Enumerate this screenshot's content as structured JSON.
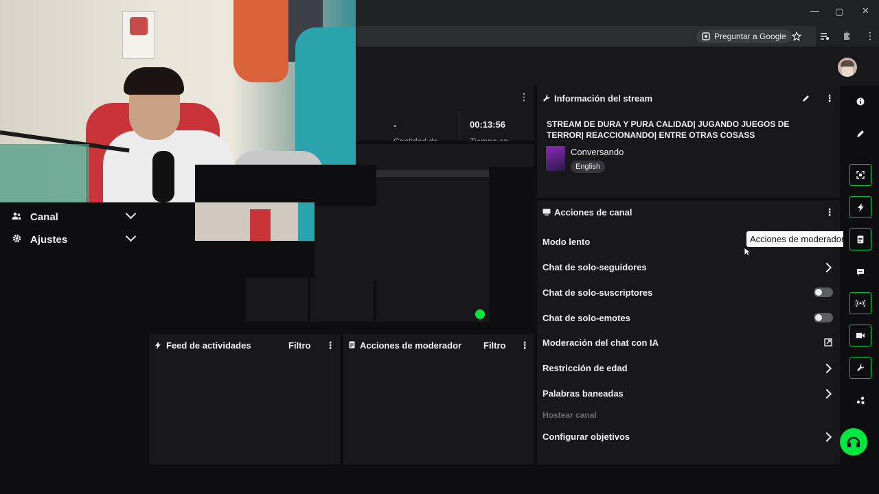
{
  "browser": {
    "ask_google": "Preguntar a Google",
    "controls": {
      "minimize": "—",
      "maximize": "▢",
      "close": "✕"
    }
  },
  "left_nav": {
    "items": [
      {
        "label": "Canal",
        "icon": "users-icon"
      },
      {
        "label": "Ajustes",
        "icon": "gear-icon"
      }
    ]
  },
  "top_stats": {
    "value1": "-",
    "value2": "00:13:56",
    "label1": "Cantidad de",
    "label2": "Tiempo en"
  },
  "stream_info": {
    "title": "Información del stream",
    "stream_title": "STREAM DE DURA Y PURA CALIDAD| JUGANDO JUEGOS DE TERROR| REACCIONANDO| ENTRE OTRAS COSASS",
    "category": "Conversando",
    "tag": "English",
    "icons": [
      "wrench-icon",
      "pencil-icon",
      "more-icon"
    ]
  },
  "channel_actions": {
    "title": "Acciones de canal",
    "rows": [
      {
        "label": "Modo lento",
        "control": "none"
      },
      {
        "label": "Chat de solo-seguidores",
        "control": "arrow"
      },
      {
        "label": "Chat de solo-suscriptores",
        "control": "toggle"
      },
      {
        "label": "Chat de solo-emotes",
        "control": "toggle"
      },
      {
        "label": "Moderación del chat con IA",
        "control": "external"
      },
      {
        "label": "Restricción de edad",
        "control": "arrow"
      },
      {
        "label": "Palabras baneadas",
        "control": "arrow"
      },
      {
        "label": "Hostear canal",
        "control": "disabled"
      },
      {
        "label": "Configurar objetivos",
        "control": "arrow"
      }
    ]
  },
  "activity_feed": {
    "title": "Feed de actividades",
    "filter": "Filtro"
  },
  "mod_actions": {
    "title": "Acciones de moderador",
    "filter": "Filtro"
  },
  "tooltip": "Acciones de moderador",
  "rail_icons": [
    "info-icon",
    "pencil-icon",
    "screenshot-icon",
    "lightning-icon",
    "document-icon",
    "chat-bubble-icon",
    "broadcast-icon",
    "video-icon",
    "wrench-icon",
    "extensions-icon"
  ],
  "colors": {
    "accent_green": "#00c853",
    "fab_green": "#00e640",
    "bg": "#0e0e10",
    "panel": "#18181b"
  }
}
